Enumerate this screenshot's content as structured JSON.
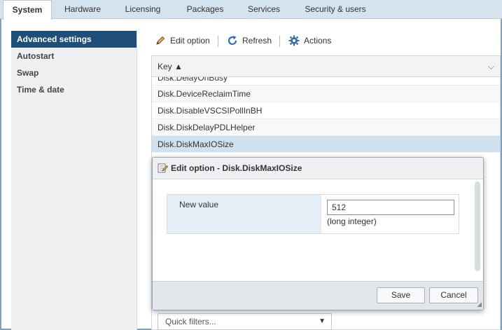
{
  "tabs": [
    {
      "label": "System"
    },
    {
      "label": "Hardware"
    },
    {
      "label": "Licensing"
    },
    {
      "label": "Packages"
    },
    {
      "label": "Services"
    },
    {
      "label": "Security & users"
    }
  ],
  "sidebar": {
    "items": [
      {
        "label": "Advanced settings"
      },
      {
        "label": "Autostart"
      },
      {
        "label": "Swap"
      },
      {
        "label": "Time & date"
      }
    ]
  },
  "toolbar": {
    "edit_label": "Edit option",
    "refresh_label": "Refresh",
    "actions_label": "Actions"
  },
  "grid": {
    "header_key": "Key ▲",
    "rows": [
      "Disk.DelayOnBusy",
      "Disk.DeviceReclaimTime",
      "Disk.DisableVSCSIPollInBH",
      "Disk.DiskDelayPDLHelper",
      "Disk.DiskMaxIOSize"
    ]
  },
  "quick_filters": {
    "label": "Quick filters..."
  },
  "dialog": {
    "title": "Edit option - Disk.DiskMaxIOSize",
    "field_label": "New value",
    "field_value": "512",
    "field_hint": "(long integer)",
    "save_label": "Save",
    "cancel_label": "Cancel"
  },
  "colors": {
    "accent": "#1f4e79",
    "selected_row": "#cfe0ee",
    "tabbar": "#d5e3ef"
  }
}
